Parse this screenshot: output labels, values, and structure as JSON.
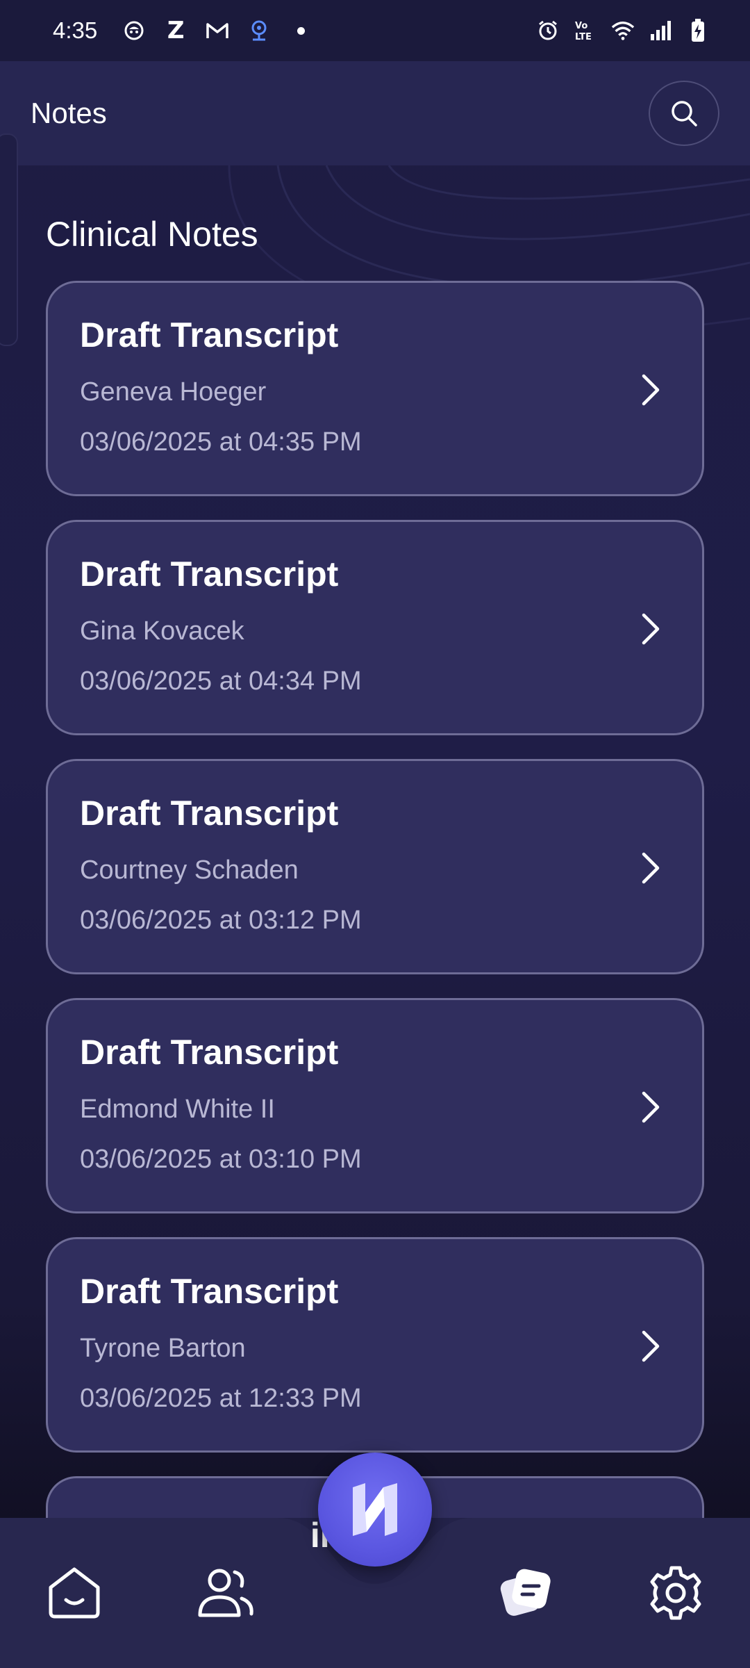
{
  "status_bar": {
    "time": "4:35",
    "left_icons": [
      "face-icon",
      "z-icon",
      "gmail-icon",
      "webcam-icon",
      "dot-icon"
    ],
    "right_icons": [
      "alarm-icon",
      "volte-icon",
      "wifi-icon",
      "signal-icon",
      "battery-charging-icon"
    ]
  },
  "header": {
    "title": "Notes",
    "search_icon": "search-icon"
  },
  "section": {
    "title": "Clinical Notes"
  },
  "notes": [
    {
      "title": "Draft Transcript",
      "patient": "Geneva Hoeger",
      "date": "03/06/2025 at 04:35 PM"
    },
    {
      "title": "Draft Transcript",
      "patient": "Gina Kovacek",
      "date": "03/06/2025 at 04:34 PM"
    },
    {
      "title": "Draft Transcript",
      "patient": "Courtney Schaden",
      "date": "03/06/2025 at 03:12 PM"
    },
    {
      "title": "Draft Transcript",
      "patient": "Edmond White II",
      "date": "03/06/2025 at 03:10 PM"
    },
    {
      "title": "Draft Transcript",
      "patient": "Tyrone Barton",
      "date": "03/06/2025 at 12:33 PM"
    }
  ],
  "partial_card_text": "int",
  "bottom_nav": {
    "items": [
      "home-icon",
      "patients-icon",
      "notes-icon",
      "settings-icon"
    ],
    "fab_icon": "n-logo-icon",
    "active": "notes-icon"
  },
  "colors": {
    "background": "#1f1d47",
    "card": "#302e5e",
    "card_border": "#6e6c96",
    "accent": "#5a56e0",
    "muted_text": "#b9b8d4"
  }
}
